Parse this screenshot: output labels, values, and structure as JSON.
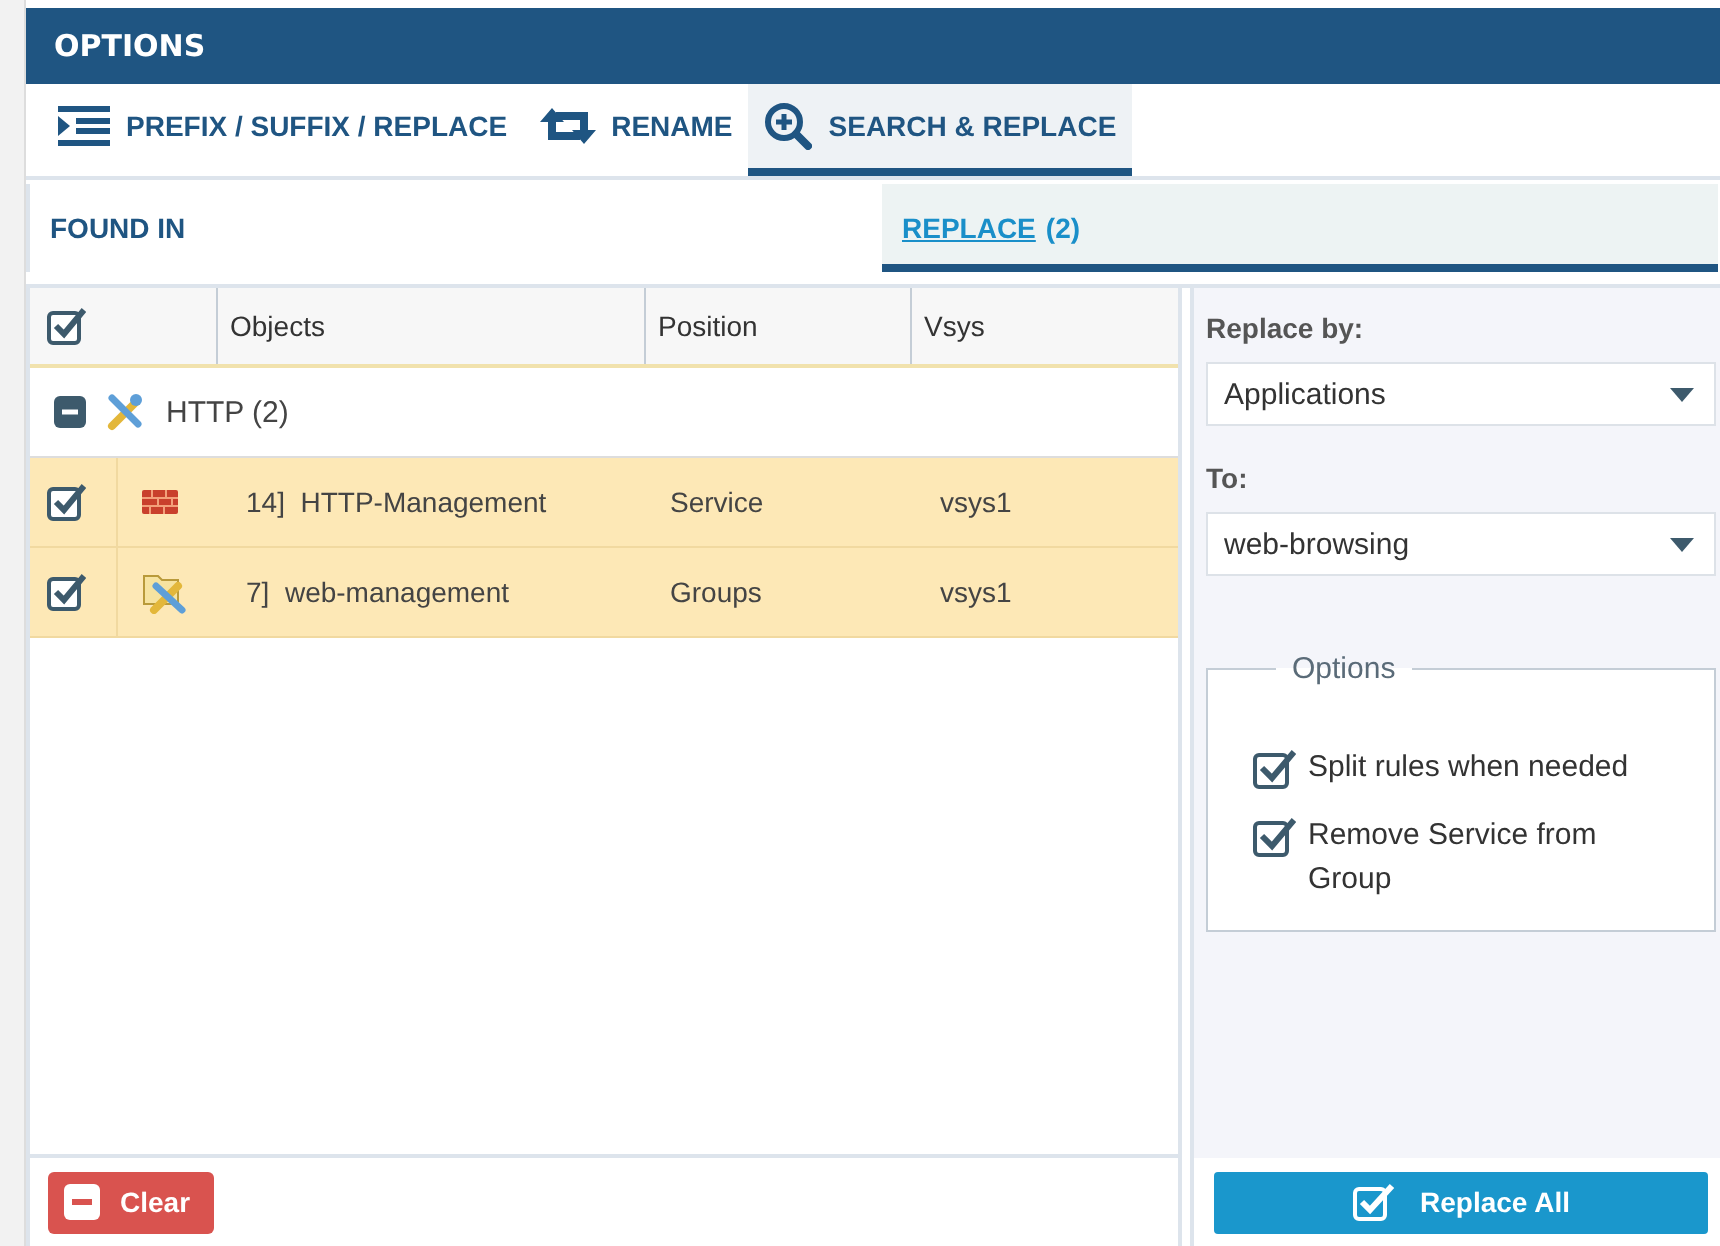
{
  "window": {
    "title": "OPTIONS"
  },
  "tabs": [
    {
      "label": "PREFIX / SUFFIX / REPLACE",
      "kind": "list",
      "selected": false
    },
    {
      "label": "RENAME",
      "kind": "rename",
      "selected": false
    },
    {
      "label": "SEARCH & REPLACE",
      "kind": "search",
      "selected": true
    }
  ],
  "section_tabs": [
    {
      "label": "FOUND IN",
      "selected": false
    },
    {
      "label": "REPLACE",
      "count": "(2)",
      "selected": true
    }
  ],
  "table": {
    "select_all_checked": true,
    "columns": [
      "Objects",
      "Position",
      "Vsys"
    ],
    "groups": [
      {
        "label": "HTTP (2)",
        "expanded": true,
        "rows": [
          {
            "checked": true,
            "kind": "service",
            "object": "14]  HTTP-Management",
            "position": "Service",
            "vsys": "vsys1"
          },
          {
            "checked": true,
            "kind": "group",
            "object": "7]  web-management",
            "position": "Groups",
            "vsys": "vsys1"
          }
        ]
      }
    ]
  },
  "clear_button": "Clear",
  "replace_panel": {
    "replace_by_label": "Replace by:",
    "replace_by": "Applications",
    "to_label": "To:",
    "to": "web-browsing",
    "options_legend": "Options",
    "options": [
      {
        "label": "Split rules when needed",
        "checked": true
      },
      {
        "label": "Remove Service from Group",
        "checked": true
      }
    ],
    "replace_all_button": "Replace All"
  }
}
